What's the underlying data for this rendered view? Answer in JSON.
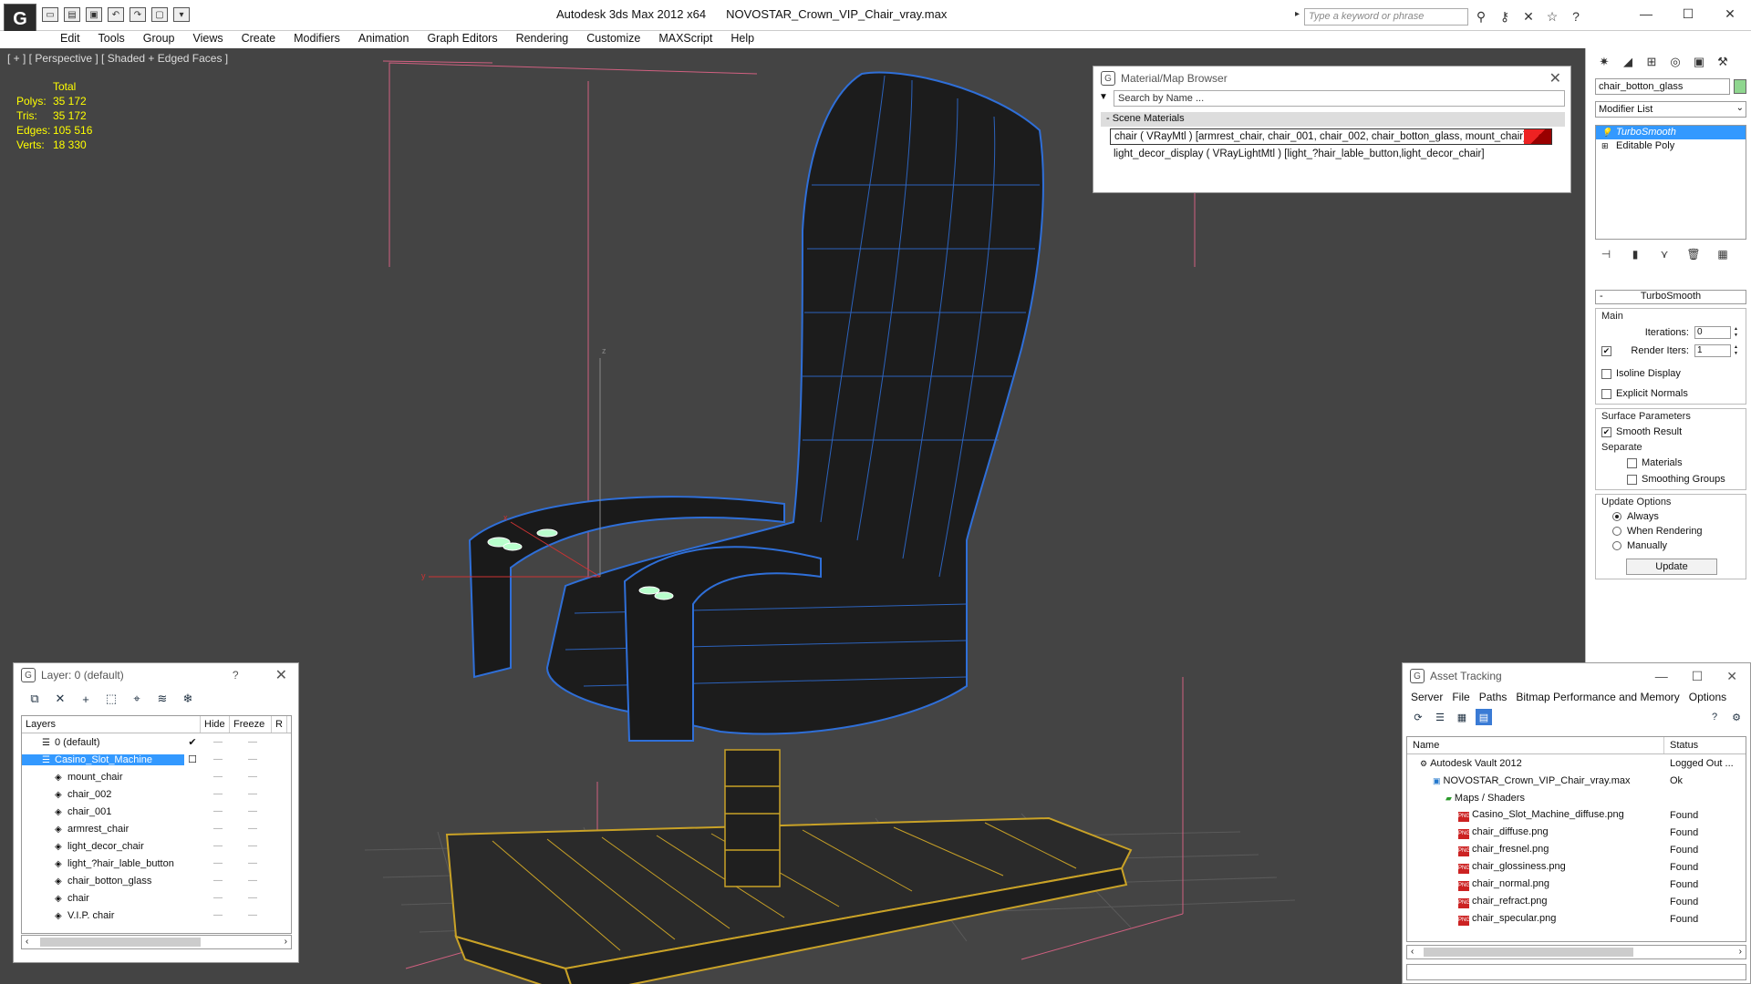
{
  "app": {
    "name": "Autodesk 3ds Max  2012 x64",
    "file": "NOVOSTAR_Crown_VIP_Chair_vray.max",
    "logo_glyph": "G"
  },
  "search": {
    "placeholder": "Type a keyword or phrase"
  },
  "menu": [
    "Edit",
    "Tools",
    "Group",
    "Views",
    "Create",
    "Modifiers",
    "Animation",
    "Graph Editors",
    "Rendering",
    "Customize",
    "MAXScript",
    "Help"
  ],
  "viewport": {
    "label": "[ + ] [ Perspective ] [ Shaded + Edged Faces ]",
    "stats": {
      "header": "Total",
      "rows": [
        {
          "k": "Polys:",
          "v": "35 172"
        },
        {
          "k": "Tris:",
          "v": "35 172"
        },
        {
          "k": "Edges:",
          "v": "105 516"
        },
        {
          "k": "Verts:",
          "v": "18 330"
        }
      ]
    },
    "axis_labels": {
      "z": "z",
      "x": "x",
      "y": "y"
    }
  },
  "material_browser": {
    "title": "Material/Map Browser",
    "search_placeholder": "Search by Name ...",
    "section": "- Scene Materials",
    "rows": [
      "chair  ( VRayMtl )  [armrest_chair, chair_001, chair_002, chair_botton_glass, mount_chair]",
      "light_decor_display  ( VRayLightMtl )  [light_?hair_lable_button,light_decor_chair]"
    ]
  },
  "command_panel": {
    "object_name": "chair_botton_glass",
    "object_color": "#8fd68f",
    "modifier_list": "Modifier List",
    "stack": [
      "TurboSmooth",
      "Editable Poly"
    ],
    "rollout_title": "TurboSmooth",
    "main_label": "Main",
    "iterations_label": "Iterations:",
    "iterations_value": "0",
    "render_iters_label": "Render Iters:",
    "render_iters_value": "1",
    "isoline_label": "Isoline Display",
    "explicit_label": "Explicit Normals",
    "surface_label": "Surface Parameters",
    "smooth_result_label": "Smooth Result",
    "separate_label": "Separate",
    "materials_label": "Materials",
    "smoothing_groups_label": "Smoothing Groups",
    "update_options_label": "Update Options",
    "always_label": "Always",
    "when_rendering_label": "When Rendering",
    "manually_label": "Manually",
    "update_button": "Update"
  },
  "layer_panel": {
    "title": "Layer: 0 (default)",
    "help": "?",
    "columns": [
      "Layers",
      "Hide",
      "Freeze",
      "R"
    ],
    "rows": [
      {
        "name": "0 (default)",
        "level": 0,
        "check": "✔"
      },
      {
        "name": "Casino_Slot_Machine",
        "level": 0,
        "selected": true,
        "check": "☐"
      },
      {
        "name": "mount_chair",
        "level": 1
      },
      {
        "name": "chair_002",
        "level": 1
      },
      {
        "name": "chair_001",
        "level": 1
      },
      {
        "name": "armrest_chair",
        "level": 1
      },
      {
        "name": "light_decor_chair",
        "level": 1
      },
      {
        "name": "light_?hair_lable_button",
        "level": 1
      },
      {
        "name": "chair_botton_glass",
        "level": 1
      },
      {
        "name": "chair",
        "level": 1
      },
      {
        "name": "V.I.P. chair",
        "level": 1
      }
    ]
  },
  "asset_tracking": {
    "title": "Asset Tracking",
    "menu": [
      "Server",
      "File",
      "Paths",
      "Bitmap Performance and Memory",
      "Options"
    ],
    "columns": [
      "Name",
      "Status"
    ],
    "rows": [
      {
        "name": "Autodesk Vault 2012",
        "status": "Logged Out ...",
        "indent": 1,
        "icon": "vault"
      },
      {
        "name": "NOVOSTAR_Crown_VIP_Chair_vray.max",
        "status": "Ok",
        "indent": 2,
        "icon": "max"
      },
      {
        "name": "Maps / Shaders",
        "status": "",
        "indent": 3,
        "icon": "folder"
      },
      {
        "name": "Casino_Slot_Machine_diffuse.png",
        "status": "Found",
        "indent": 4,
        "icon": "png"
      },
      {
        "name": "chair_diffuse.png",
        "status": "Found",
        "indent": 4,
        "icon": "png"
      },
      {
        "name": "chair_fresnel.png",
        "status": "Found",
        "indent": 4,
        "icon": "png"
      },
      {
        "name": "chair_glossiness.png",
        "status": "Found",
        "indent": 4,
        "icon": "png"
      },
      {
        "name": "chair_normal.png",
        "status": "Found",
        "indent": 4,
        "icon": "png"
      },
      {
        "name": "chair_refract.png",
        "status": "Found",
        "indent": 4,
        "icon": "png"
      },
      {
        "name": "chair_specular.png",
        "status": "Found",
        "indent": 4,
        "icon": "png"
      }
    ]
  }
}
